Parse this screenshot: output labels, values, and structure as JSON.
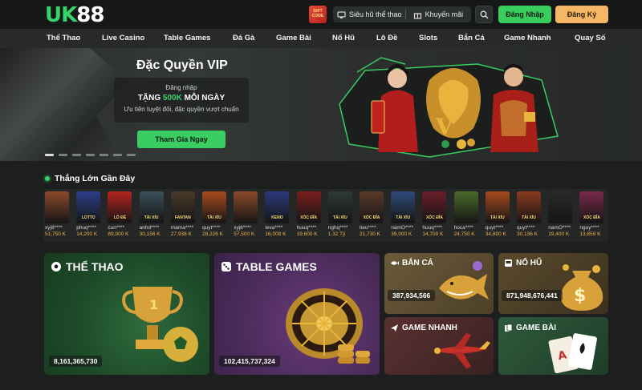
{
  "colors": {
    "accent_green": "#38cd5c",
    "accent_orange": "#f5b765",
    "gold": "#f2b24a"
  },
  "header": {
    "logo_uk": "UK",
    "logo_88": "88",
    "giftcode_label": "GIFT CODE",
    "sieuhu_label": "Siêu hũ thể thao",
    "khuyenmai_label": "Khuyến mãi",
    "login_label": "Đăng Nhập",
    "register_label": "Đăng Ký"
  },
  "nav": {
    "items": [
      "Thể Thao",
      "Live Casino",
      "Table Games",
      "Đá Gà",
      "Game Bài",
      "Nổ Hũ",
      "Lô Đề",
      "Slots",
      "Bắn Cá",
      "Game Nhanh",
      "Quay Số"
    ]
  },
  "banner": {
    "title": "Đặc Quyền VIP",
    "line1": "Đăng nhập",
    "line2_prefix": "TẶNG ",
    "line2_highlight": "500K",
    "line2_suffix": " MỖI NGÀY",
    "line3": "Ưu tiên tuyệt đối, đặc quyền vượt chuẩn",
    "cta": "Tham Gia Ngay",
    "slides_total": 7,
    "slide_active": 1
  },
  "recent_wins": {
    "title": "Thắng Lớn Gần Đây",
    "items": [
      {
        "user": "xyj8****",
        "amount": "51,750 K",
        "thumb": "",
        "color": "#8b4a2a"
      },
      {
        "user": "phuq****",
        "amount": "14,200 K",
        "thumb": "LOTTO",
        "color": "#2c3f8a"
      },
      {
        "user": "cun****",
        "amount": "89,900 K",
        "thumb": "LÔ ĐỀ",
        "color": "#b5241e"
      },
      {
        "user": "anhd****",
        "amount": "30,156 K",
        "thumb": "TÀI XỈU",
        "color": "#3a4f5a"
      },
      {
        "user": "mama****",
        "amount": "27,938 K",
        "thumb": "FANTAN",
        "color": "#4a3a2a"
      },
      {
        "user": "quyt****",
        "amount": "28,226 K",
        "thumb": "TÀI XỈU",
        "color": "#a84a1e"
      },
      {
        "user": "xyj8****",
        "amount": "57,500 K",
        "thumb": "",
        "color": "#8b4a2a"
      },
      {
        "user": "leva****",
        "amount": "16,008 K",
        "thumb": "KENO",
        "color": "#2a3a7a"
      },
      {
        "user": "huuq****",
        "amount": "19,600 K",
        "thumb": "XÓC ĐĨA",
        "color": "#7a1e1e"
      },
      {
        "user": "nghq****",
        "amount": "1.32 Tỷ",
        "thumb": "TÀI XỈU",
        "color": "#2e3a33"
      },
      {
        "user": "tieu****",
        "amount": "21,730 K",
        "thumb": "XÓC ĐĨA",
        "color": "#5a3a2a"
      },
      {
        "user": "namO****",
        "amount": "39,000 K",
        "thumb": "TÀI XỈU",
        "color": "#2e4a7a"
      },
      {
        "user": "huuq****",
        "amount": "14,700 K",
        "thumb": "XÓC ĐĨA",
        "color": "#6a1e2a"
      },
      {
        "user": "hoca****",
        "amount": "24,750 K",
        "thumb": "",
        "color": "#4a6a2a"
      },
      {
        "user": "quyt****",
        "amount": "34,800 K",
        "thumb": "TÀI XỈU",
        "color": "#a84a1e"
      },
      {
        "user": "quyt****",
        "amount": "30,136 K",
        "thumb": "TÀI XỈU",
        "color": "#8a3a1e"
      },
      {
        "user": "namO****",
        "amount": "19,400 K",
        "thumb": "",
        "color": "#2a2a2a"
      },
      {
        "user": "nguy****",
        "amount": "13,859 K",
        "thumb": "XÓC ĐĨA",
        "color": "#7a2a4a"
      }
    ]
  },
  "categories": {
    "sports": {
      "title": "THỂ THAO",
      "value": "8,161,365,730"
    },
    "tablegames": {
      "title": "TABLE GAMES",
      "value": "102,415,737,324"
    },
    "banca": {
      "title": "BẮN CÁ",
      "value": "387,934,566"
    },
    "nohu": {
      "title": "NỔ HŨ",
      "value": "871,948,676,441"
    },
    "gamenhanh": {
      "title": "GAME NHANH",
      "value": ""
    },
    "gamebai": {
      "title": "GAME BÀI",
      "value": ""
    }
  }
}
